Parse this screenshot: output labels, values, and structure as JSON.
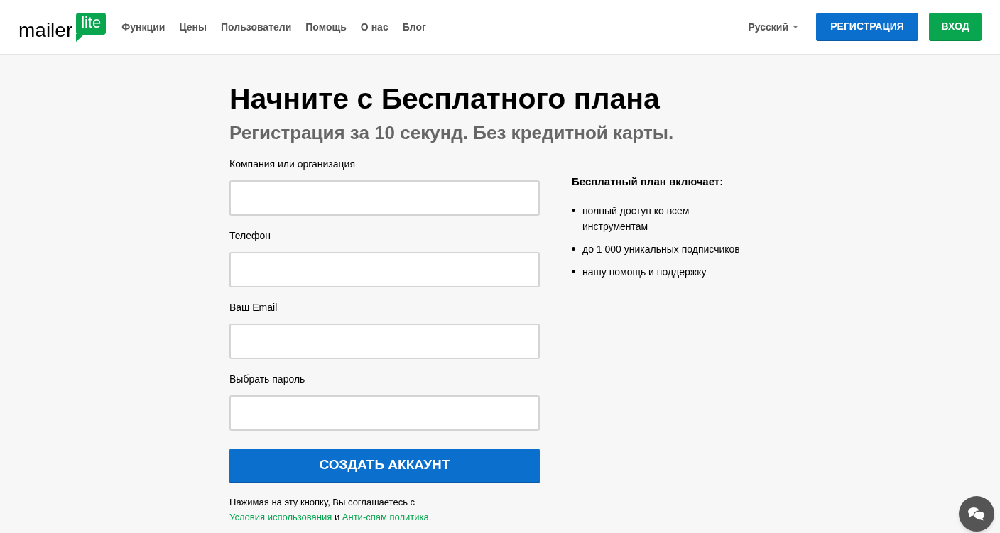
{
  "header": {
    "logo": {
      "word": "mailer",
      "badge": "lite"
    },
    "nav": [
      "Функции",
      "Цены",
      "Пользователи",
      "Помощь",
      "О нас",
      "Блог"
    ],
    "language": "Русский",
    "signup_button": "РЕГИСТРАЦИЯ",
    "login_button": "ВХОД"
  },
  "main": {
    "title": "Начните с Бесплатного плана",
    "subtitle": "Регистрация за 10 секунд. Без кредитной карты.",
    "fields": [
      {
        "label": "Компания или организация"
      },
      {
        "label": "Телефон"
      },
      {
        "label": "Ваш Email"
      },
      {
        "label": "Выбрать пароль"
      }
    ],
    "submit": "СОЗДАТЬ АККАУНТ",
    "terms": {
      "before": "Нажимая на эту кнопку, Вы соглашаетесь с",
      "link_1": "Условия использования",
      "middle": "и",
      "link_2": "Анти-спам политика",
      "end": "."
    },
    "plan": {
      "title": "Бесплатный план включает:",
      "items": [
        "полный доступ ко всем инструментам",
        "до 1 000 уникальных подписчиков",
        "нашу помощь и поддержку"
      ]
    }
  }
}
